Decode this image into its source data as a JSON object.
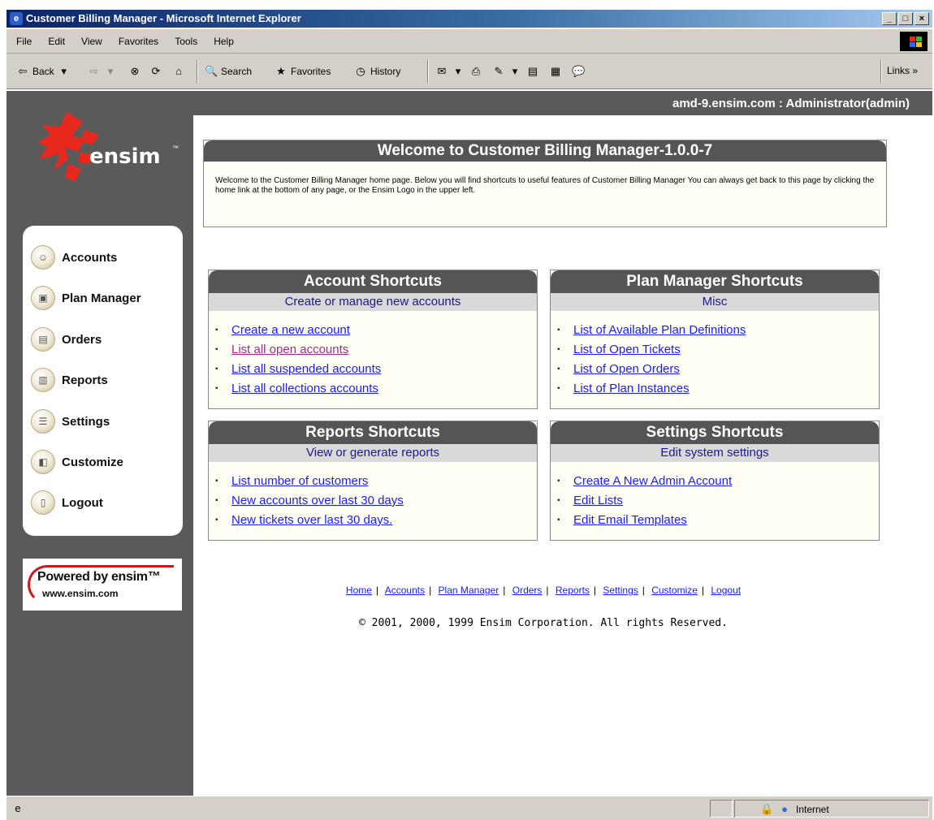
{
  "window": {
    "title": "Customer Billing Manager - Microsoft Internet Explorer",
    "controls": [
      "_",
      "□",
      "×"
    ]
  },
  "menu": [
    "File",
    "Edit",
    "View",
    "Favorites",
    "Tools",
    "Help"
  ],
  "toolbar": {
    "back": "Back",
    "search": "Search",
    "favorites": "Favorites",
    "history": "History",
    "links": "Links »"
  },
  "header": {
    "user_info": "amd-9.ensim.com : Administrator(admin)"
  },
  "logo": {
    "wordmark": "ensim",
    "tm": "™"
  },
  "nav": [
    {
      "label": "Accounts",
      "icon": "accounts-icon"
    },
    {
      "label": "Plan Manager",
      "icon": "plan-manager-icon"
    },
    {
      "label": "Orders",
      "icon": "orders-icon"
    },
    {
      "label": "Reports",
      "icon": "reports-icon"
    },
    {
      "label": "Settings",
      "icon": "settings-icon"
    },
    {
      "label": "Customize",
      "icon": "customize-icon"
    },
    {
      "label": "Logout",
      "icon": "logout-icon"
    }
  ],
  "powered": {
    "line1": "Powered by ensim™",
    "line2": "www.ensim.com"
  },
  "welcome": {
    "title": "Welcome to Customer Billing Manager-1.0.0-7",
    "text": "Welcome to the Customer Billing Manager home page. Below you will find shortcuts to useful features of Customer Billing Manager You can always get back to this page by clicking the home link at the bottom of any page, or the Ensim Logo in the upper left."
  },
  "shortcuts": {
    "account": {
      "title": "Account Shortcuts",
      "subtitle": "Create or manage new accounts",
      "links": [
        "Create a new account",
        "List all open accounts",
        "List all suspended accounts",
        "List all collections accounts"
      ]
    },
    "plan": {
      "title": "Plan Manager Shortcuts",
      "subtitle": "Misc",
      "links": [
        "List of Available Plan Definitions",
        "List of Open Tickets",
        "List of Open Orders",
        "List of Plan Instances"
      ]
    },
    "reports": {
      "title": "Reports Shortcuts",
      "subtitle": "View or generate reports",
      "links": [
        "List number of customers",
        "New accounts over last 30 days",
        "New tickets over last 30 days."
      ]
    },
    "settings": {
      "title": "Settings Shortcuts",
      "subtitle": "Edit system settings",
      "links": [
        "Create A New Admin Account",
        "Edit Lists",
        "Edit Email Templates"
      ]
    }
  },
  "footer": {
    "links": [
      "Home",
      "Accounts",
      "Plan Manager",
      "Orders",
      "Reports",
      "Settings",
      "Customize",
      "Logout"
    ],
    "separator": "|",
    "copyright": "© 2001, 2000, 1999 Ensim Corporation. All rights Reserved."
  },
  "status": {
    "zone": "Internet"
  },
  "colors": {
    "sidebar": "#5a5a5a",
    "box_header": "#555555",
    "link": "#1a1aff",
    "visited_link": "#a12a8c",
    "logo_red": "#e8281c"
  }
}
